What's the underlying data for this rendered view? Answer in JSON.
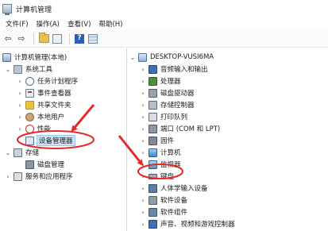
{
  "window": {
    "title": "计算机管理"
  },
  "menu": {
    "items": [
      "文件(F)",
      "操作(A)",
      "查看(V)",
      "帮助(H)"
    ]
  },
  "toolbar": {
    "buttons": [
      {
        "icon": "back-arrow-icon",
        "glyph": "⇦"
      },
      {
        "icon": "forward-arrow-icon",
        "glyph": "⇨"
      },
      {
        "icon": "folder-up-icon"
      },
      {
        "icon": "show-hide-tree-icon"
      },
      {
        "icon": "help-icon",
        "glyph": "?"
      },
      {
        "icon": "properties-icon"
      }
    ]
  },
  "left_tree": {
    "root": "计算机管理(本地)",
    "system_tools": "系统工具",
    "task_scheduler": "任务计划程序",
    "event_viewer": "事件查看器",
    "shared_folders": "共享文件夹",
    "local_users": "本地用户",
    "performance": "性能",
    "device_manager": "设备管理器",
    "storage": "存储",
    "disk_management": "磁盘管理",
    "services": "服务和应用程序"
  },
  "right_tree": {
    "computer": "DESKTOP-VUSI6MA",
    "items": [
      "音频输入和输出",
      "处理器",
      "磁盘驱动器",
      "存储控制器",
      "打印队列",
      "端口 (COM 和 LPT)",
      "固件",
      "计算机",
      "监视器",
      "键盘",
      "人体学输入设备",
      "软件设备",
      "软件组件",
      "声音、视频和游戏控制器"
    ]
  },
  "colors": {
    "annotation_red": "#e52a2a",
    "selection_bg": "#cce4f7",
    "selection_border": "#99c9ef"
  }
}
